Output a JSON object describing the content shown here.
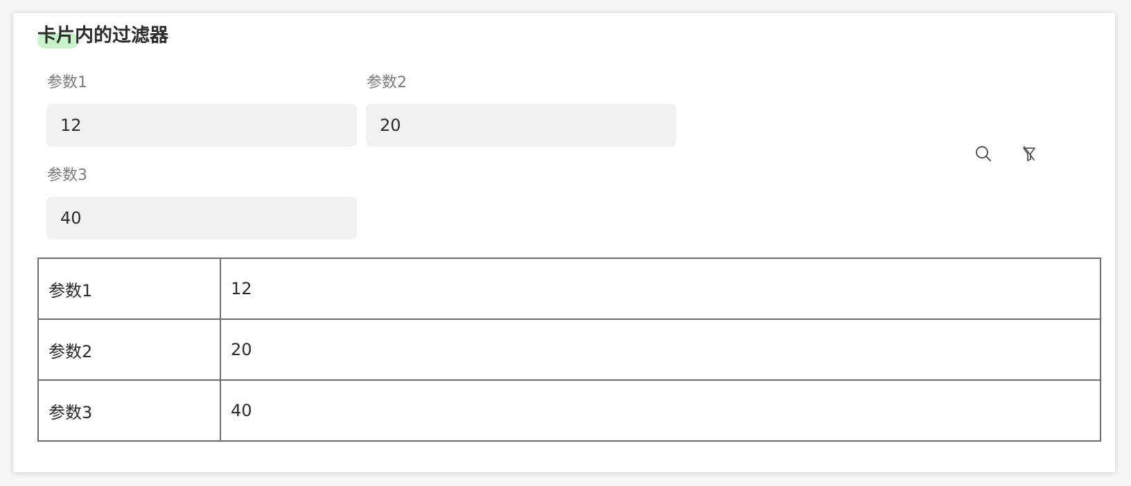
{
  "card": {
    "title": "卡片内的过滤器"
  },
  "filters": [
    {
      "label": "参数1",
      "value": "12"
    },
    {
      "label": "参数2",
      "value": "20"
    },
    {
      "label": "参数3",
      "value": "40"
    }
  ],
  "actions": {
    "search_icon": "search-icon",
    "clear_filter_icon": "filter-clear-icon"
  },
  "table": {
    "rows": [
      {
        "key": "参数1",
        "value": "12"
      },
      {
        "key": "参数2",
        "value": "20"
      },
      {
        "key": "参数3",
        "value": "40"
      }
    ]
  },
  "colors": {
    "title_highlight": "#c8f2c9",
    "input_background": "#f1f1f1",
    "table_border": "#6d6d6d"
  }
}
